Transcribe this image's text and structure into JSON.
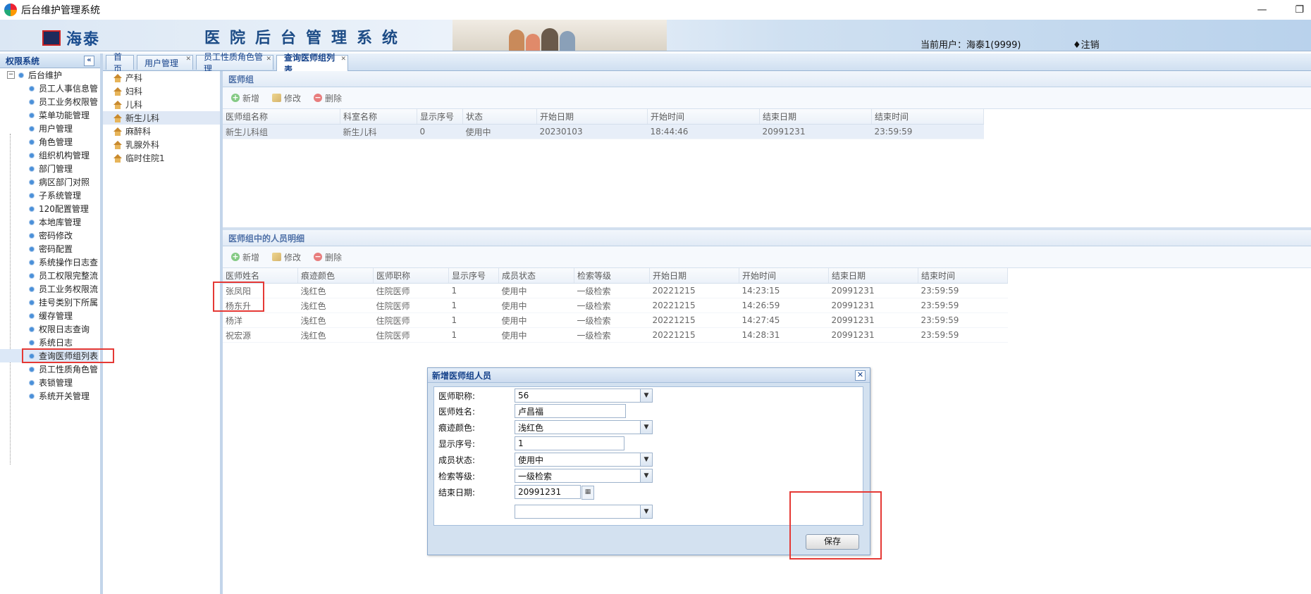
{
  "window": {
    "title": "后台维护管理系统",
    "minimize": "—",
    "maximize": "❐"
  },
  "banner": {
    "brand": "海泰",
    "system_title": "医院后台管理系统",
    "current_user": "当前用户：海泰1(9999)",
    "logout": "♦注销"
  },
  "left_panel": {
    "title": "权限系统",
    "root": "后台维护",
    "items": [
      "员工人事信息管",
      "员工业务权限管",
      "菜单功能管理",
      "用户管理",
      "角色管理",
      "组织机构管理",
      "部门管理",
      "病区部门对照",
      "子系统管理",
      "120配置管理",
      "本地库管理",
      "密码修改",
      "密码配置",
      "系统操作日志查",
      "员工权限完整流",
      "员工业务权限流",
      "挂号类别下所属",
      "缓存管理",
      "权限日志查询",
      "系统日志",
      "查询医师组列表",
      "员工性质角色管",
      "表锁管理",
      "系统开关管理"
    ],
    "selected": "查询医师组列表"
  },
  "tabs": [
    {
      "label": "首页",
      "closable": false
    },
    {
      "label": "用户管理",
      "closable": true
    },
    {
      "label": "员工性质角色管理",
      "closable": true
    },
    {
      "label": "查询医师组列表",
      "closable": true,
      "active": true
    }
  ],
  "departments": [
    "产科",
    "妇科",
    "儿科",
    "新生儿科",
    "麻醉科",
    "乳腺外科",
    "临时住院1"
  ],
  "selected_department": "新生儿科",
  "group_panel": {
    "title": "医师组",
    "toolbar": {
      "add": "新增",
      "edit": "修改",
      "delete": "删除"
    },
    "columns": [
      "医师组名称",
      "科室名称",
      "显示序号",
      "状态",
      "开始日期",
      "开始时间",
      "结束日期",
      "结束时间"
    ],
    "rows": [
      [
        "新生儿科组",
        "新生儿科",
        "0",
        "使用中",
        "20230103",
        "18:44:46",
        "20991231",
        "23:59:59"
      ]
    ]
  },
  "member_panel": {
    "title": "医师组中的人员明细",
    "toolbar": {
      "add": "新增",
      "edit": "修改",
      "delete": "删除"
    },
    "columns": [
      "医师姓名",
      "痕迹颜色",
      "医师职称",
      "显示序号",
      "成员状态",
      "检索等级",
      "开始日期",
      "开始时间",
      "结束日期",
      "结束时间"
    ],
    "rows": [
      [
        "张凤阳",
        "浅红色",
        "住院医师",
        "1",
        "使用中",
        "一级检索",
        "20221215",
        "14:23:15",
        "20991231",
        "23:59:59"
      ],
      [
        "杨东升",
        "浅红色",
        "住院医师",
        "1",
        "使用中",
        "一级检索",
        "20221215",
        "14:26:59",
        "20991231",
        "23:59:59"
      ],
      [
        "杨洋",
        "浅红色",
        "住院医师",
        "1",
        "使用中",
        "一级检索",
        "20221215",
        "14:27:45",
        "20991231",
        "23:59:59"
      ],
      [
        "祝宏源",
        "浅红色",
        "住院医师",
        "1",
        "使用中",
        "一级检索",
        "20221215",
        "14:28:31",
        "20991231",
        "23:59:59"
      ]
    ]
  },
  "dialog": {
    "title": "新增医师组人员",
    "fields": {
      "title_label": "医师职称:",
      "title_value": "56",
      "name_label": "医师姓名:",
      "name_value": "卢昌福",
      "color_label": "痕迹颜色:",
      "color_value": "浅红色",
      "order_label": "显示序号:",
      "order_value": "1",
      "status_label": "成员状态:",
      "status_value": "使用中",
      "level_label": "检索等级:",
      "level_value": "一级检索",
      "end_label": "结束日期:",
      "end_value": "20991231"
    },
    "save": "保存"
  },
  "colors": {
    "header_blue": "#15428b",
    "highlight": "#e53935",
    "panel_bg": "#d3e1f0"
  }
}
